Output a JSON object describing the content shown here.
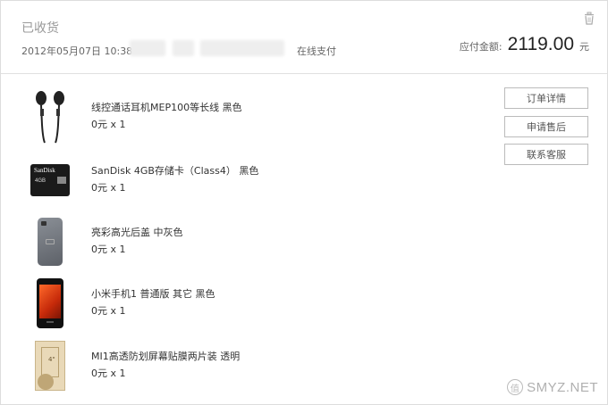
{
  "order": {
    "status": "已收货",
    "datetime": "2012年05月07日 10:38",
    "payment_method": "在线支付",
    "amount_label": "应付金额:",
    "amount_value": "2119.00",
    "amount_currency": "元"
  },
  "items": [
    {
      "name": "线控通话耳机MEP100等长线 黑色",
      "price": "0元 x 1",
      "icon": "earphones-image"
    },
    {
      "name": "SanDisk 4GB存储卡（Class4） 黑色",
      "price": "0元 x 1",
      "icon": "sd-card-image",
      "card_brand": "SanDisk",
      "card_size": "4GB"
    },
    {
      "name": "亮彩高光后盖 中灰色",
      "price": "0元 x 1",
      "icon": "back-cover-image"
    },
    {
      "name": "小米手机1 普通版 其它 黑色",
      "price": "0元 x 1",
      "icon": "phone-image"
    },
    {
      "name": "MI1高透防划屏幕贴膜两片装 透明",
      "price": "0元 x 1",
      "icon": "screen-protector-image",
      "pack_label": "4\""
    }
  ],
  "actions": {
    "order_detail": "订单详情",
    "after_sales": "申请售后",
    "contact_service": "联系客服"
  },
  "watermark": {
    "text": "SMYZ.NET",
    "logo_char": "值"
  }
}
